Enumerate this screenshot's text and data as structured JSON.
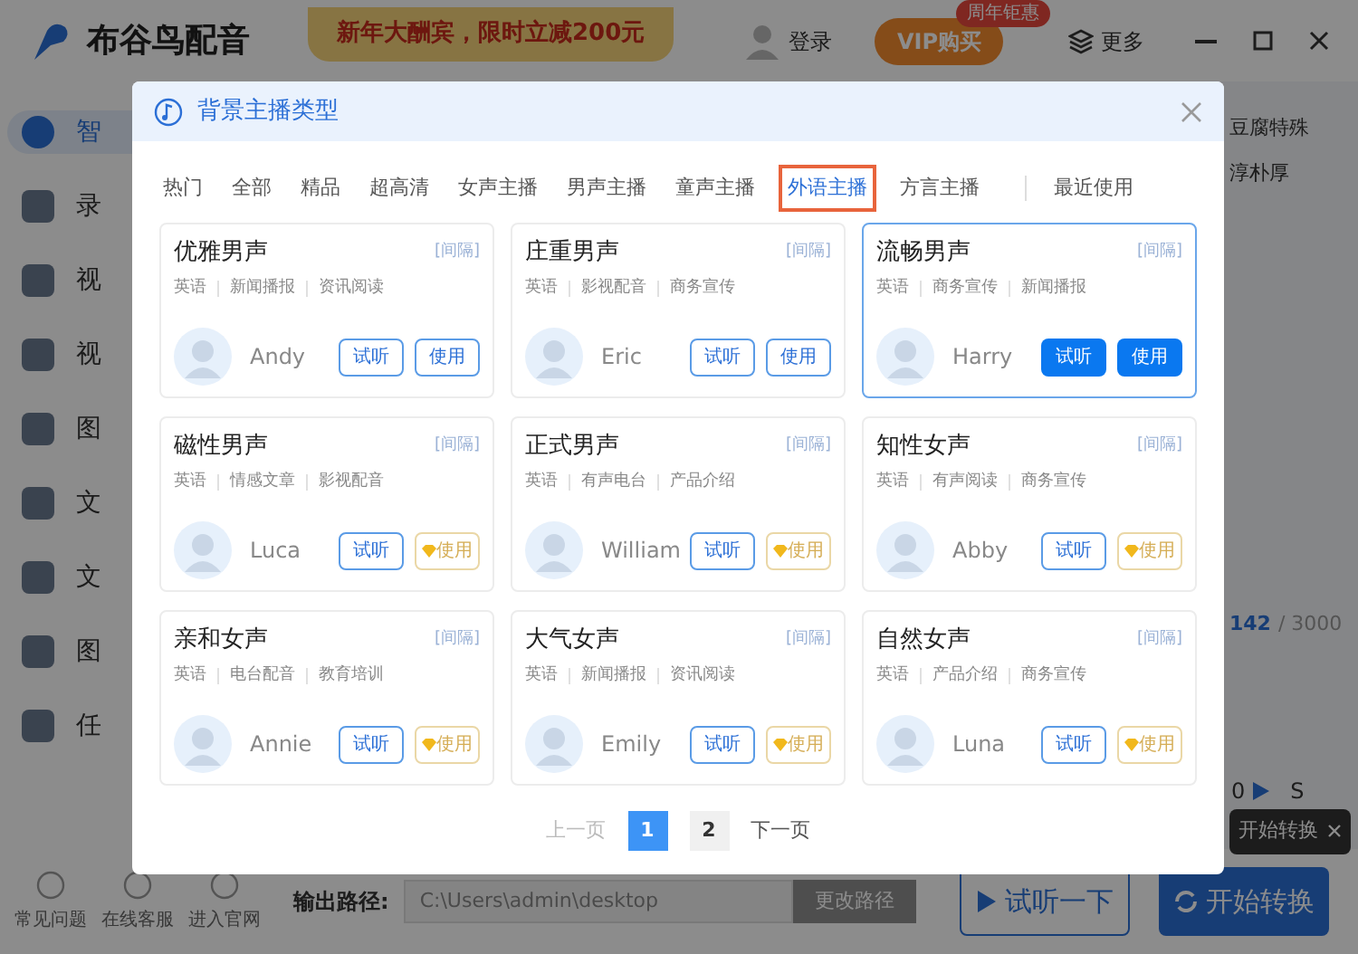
{
  "app": {
    "title": "布谷鸟配音",
    "promo_banner": "新年大酬宾，限时立减200元",
    "login": "登录",
    "vip": {
      "label": "VIP购买",
      "badge": "周年钜惠"
    },
    "more": "更多",
    "sidebar": [
      {
        "label": "智",
        "selected": true
      },
      {
        "label": "录",
        "selected": false
      },
      {
        "label": "视",
        "selected": false
      },
      {
        "label": "视",
        "selected": false
      },
      {
        "label": "图",
        "selected": false
      },
      {
        "label": "文",
        "selected": false
      },
      {
        "label": "文",
        "selected": false
      },
      {
        "label": "图",
        "selected": false
      },
      {
        "label": "任",
        "selected": false
      }
    ],
    "editor_lines": [
      "豆腐特殊",
      "淳朴厚"
    ],
    "counter": {
      "count": "142",
      "total": "/ 3000"
    },
    "player": {
      "time": "0",
      "label": "S"
    },
    "links": [
      "常见问题",
      "在线客服",
      "进入官网"
    ],
    "output_label": "输出路径:",
    "output_path": "C:\\Users\\admin\\desktop",
    "change_path_button": "更改路径",
    "preview_button": "试听一下",
    "convert_button": "开始转换",
    "tooltip": "开始转换"
  },
  "dialog": {
    "title": "背景主播类型",
    "tabs": [
      {
        "label": "热门",
        "selected": false
      },
      {
        "label": "全部",
        "selected": false
      },
      {
        "label": "精品",
        "selected": false
      },
      {
        "label": "超高清",
        "selected": false
      },
      {
        "label": "女声主播",
        "selected": false
      },
      {
        "label": "男声主播",
        "selected": false
      },
      {
        "label": "童声主播",
        "selected": false
      },
      {
        "label": "外语主播",
        "selected": true
      },
      {
        "label": "方言主播",
        "selected": false
      },
      {
        "label": "最近使用",
        "selected": false
      }
    ],
    "cards": [
      {
        "title": "优雅男声",
        "pause_tag": "[间隔]",
        "tags": [
          "英语",
          "新闻播报",
          "资讯阅读"
        ],
        "name": "Andy",
        "selected": false,
        "listen": "试听",
        "use": "使用",
        "vip": false
      },
      {
        "title": "庄重男声",
        "pause_tag": "[间隔]",
        "tags": [
          "英语",
          "影视配音",
          "商务宣传"
        ],
        "name": "Eric",
        "selected": false,
        "listen": "试听",
        "use": "使用",
        "vip": false
      },
      {
        "title": "流畅男声",
        "pause_tag": "[间隔]",
        "tags": [
          "英语",
          "商务宣传",
          "新闻播报"
        ],
        "name": "Harry",
        "selected": true,
        "listen": "试听",
        "use": "使用",
        "vip": false
      },
      {
        "title": "磁性男声",
        "pause_tag": "[间隔]",
        "tags": [
          "英语",
          "情感文章",
          "影视配音"
        ],
        "name": "Luca",
        "selected": false,
        "listen": "试听",
        "use": "使用",
        "vip": true
      },
      {
        "title": "正式男声",
        "pause_tag": "[间隔]",
        "tags": [
          "英语",
          "有声电台",
          "产品介绍"
        ],
        "name": "William",
        "selected": false,
        "listen": "试听",
        "use": "使用",
        "vip": true
      },
      {
        "title": "知性女声",
        "pause_tag": "[间隔]",
        "tags": [
          "英语",
          "有声阅读",
          "商务宣传"
        ],
        "name": "Abby",
        "selected": false,
        "listen": "试听",
        "use": "使用",
        "vip": true
      },
      {
        "title": "亲和女声",
        "pause_tag": "[间隔]",
        "tags": [
          "英语",
          "电台配音",
          "教育培训"
        ],
        "name": "Annie",
        "selected": false,
        "listen": "试听",
        "use": "使用",
        "vip": true
      },
      {
        "title": "大气女声",
        "pause_tag": "[间隔]",
        "tags": [
          "英语",
          "新闻播报",
          "资讯阅读"
        ],
        "name": "Emily",
        "selected": false,
        "listen": "试听",
        "use": "使用",
        "vip": true
      },
      {
        "title": "自然女声",
        "pause_tag": "[间隔]",
        "tags": [
          "英语",
          "产品介绍",
          "商务宣传"
        ],
        "name": "Luna",
        "selected": false,
        "listen": "试听",
        "use": "使用",
        "vip": true
      }
    ],
    "pagination": {
      "prev": "上一页",
      "pages": [
        {
          "label": "1",
          "selected": true
        },
        {
          "label": "2",
          "selected": false
        }
      ],
      "next": "下一页"
    }
  }
}
